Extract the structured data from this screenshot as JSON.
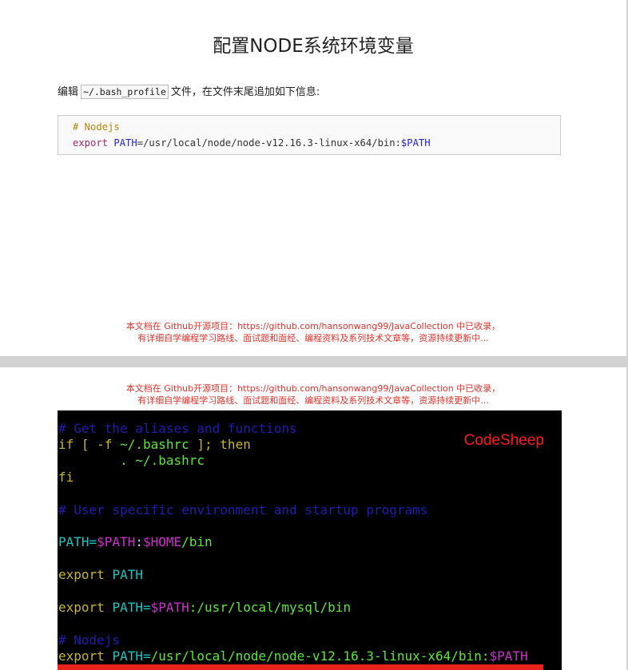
{
  "page1": {
    "title": "配置NODE系统环境变量",
    "intro_before": "编辑",
    "intro_code": "~/.bash_profile",
    "intro_after": "文件，在文件末尾追加如下信息:",
    "code": {
      "comment": "# Nodejs",
      "export_kw": "export",
      "path_var": "PATH",
      "path_value": "=/usr/local/node/node-v12.16.3-linux-x64/bin:",
      "path_ref": "$PATH"
    },
    "footer_line1": "本文档在 Github开源项目：https://github.com/hansonwang99/JavaCollection 中已收录，",
    "footer_line2": "有详细自学编程学习路线、面试题和面经、编程资料及系列技术文章等，资源持续更新中..."
  },
  "page2": {
    "header_line1": "本文档在 Github开源项目：https://github.com/hansonwang99/JavaCollection 中已收录，",
    "header_line2": "有详细自学编程学习路线、面试题和面经、编程资料及系列技术文章等，资源持续更新中...",
    "brand": "CodeSheep",
    "terminal": {
      "l1": "# Get the aliases and functions",
      "l2_if": "if [ -f ",
      "l2_file": "~/.bashrc",
      "l2_end": " ]; then",
      "l3": "        . ~/.bashrc",
      "l4": "fi",
      "l6": "# User specific environment and startup programs",
      "l8_var": "PATH=",
      "l8_ref1": "$PATH",
      "l8_colon": ":",
      "l8_ref2": "$HOME",
      "l8_bin": "/bin",
      "l10_kw": "export ",
      "l10_var": "PATH",
      "l12_kw": "export ",
      "l12_var": "PATH=",
      "l12_ref": "$PATH",
      "l12_val": ":/usr/local/mysql/bin",
      "l14": "# Nodejs",
      "l15_kw": "export ",
      "l15_var": "PATH=",
      "l15_val": "/usr/local/node/node-v12.16.3-linux-x64/bin:",
      "l15_ref": "$PATH"
    }
  }
}
